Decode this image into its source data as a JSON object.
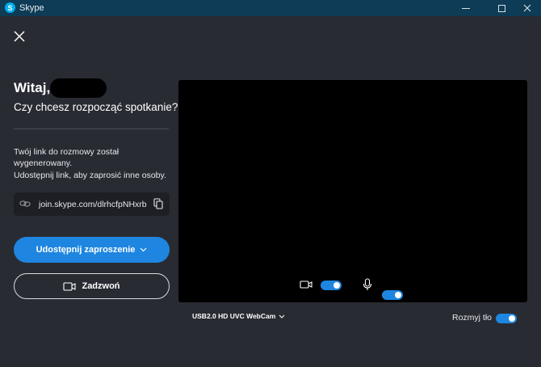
{
  "window": {
    "app_icon_letter": "S",
    "title": "Skype",
    "controls": {
      "minimize": "minimize",
      "maximize": "maximize",
      "close": "×"
    }
  },
  "greeting": {
    "hello": "Witaj,",
    "question": "Czy chcesz rozpocząć spotkanie?"
  },
  "info": {
    "line1": "Twój link do rozmowy został",
    "line2": "wygenerowany.",
    "line3": "Udostępnij link, aby zaprosić inne osoby."
  },
  "link": {
    "url": "join.skype.com/dlrhcfpNHxrb"
  },
  "buttons": {
    "share_label": "Udostępnij zaproszenie",
    "call_label": "Zadzwoń"
  },
  "preview": {
    "camera_on": true,
    "mic_on": true
  },
  "camera_select": {
    "value": "USB2.0 HD UVC WebCam"
  },
  "blur": {
    "label": "Rozmyj tło",
    "on": true
  },
  "colors": {
    "accent": "#1e86e0",
    "background": "#292b33",
    "titlebar": "#0e3b55"
  }
}
